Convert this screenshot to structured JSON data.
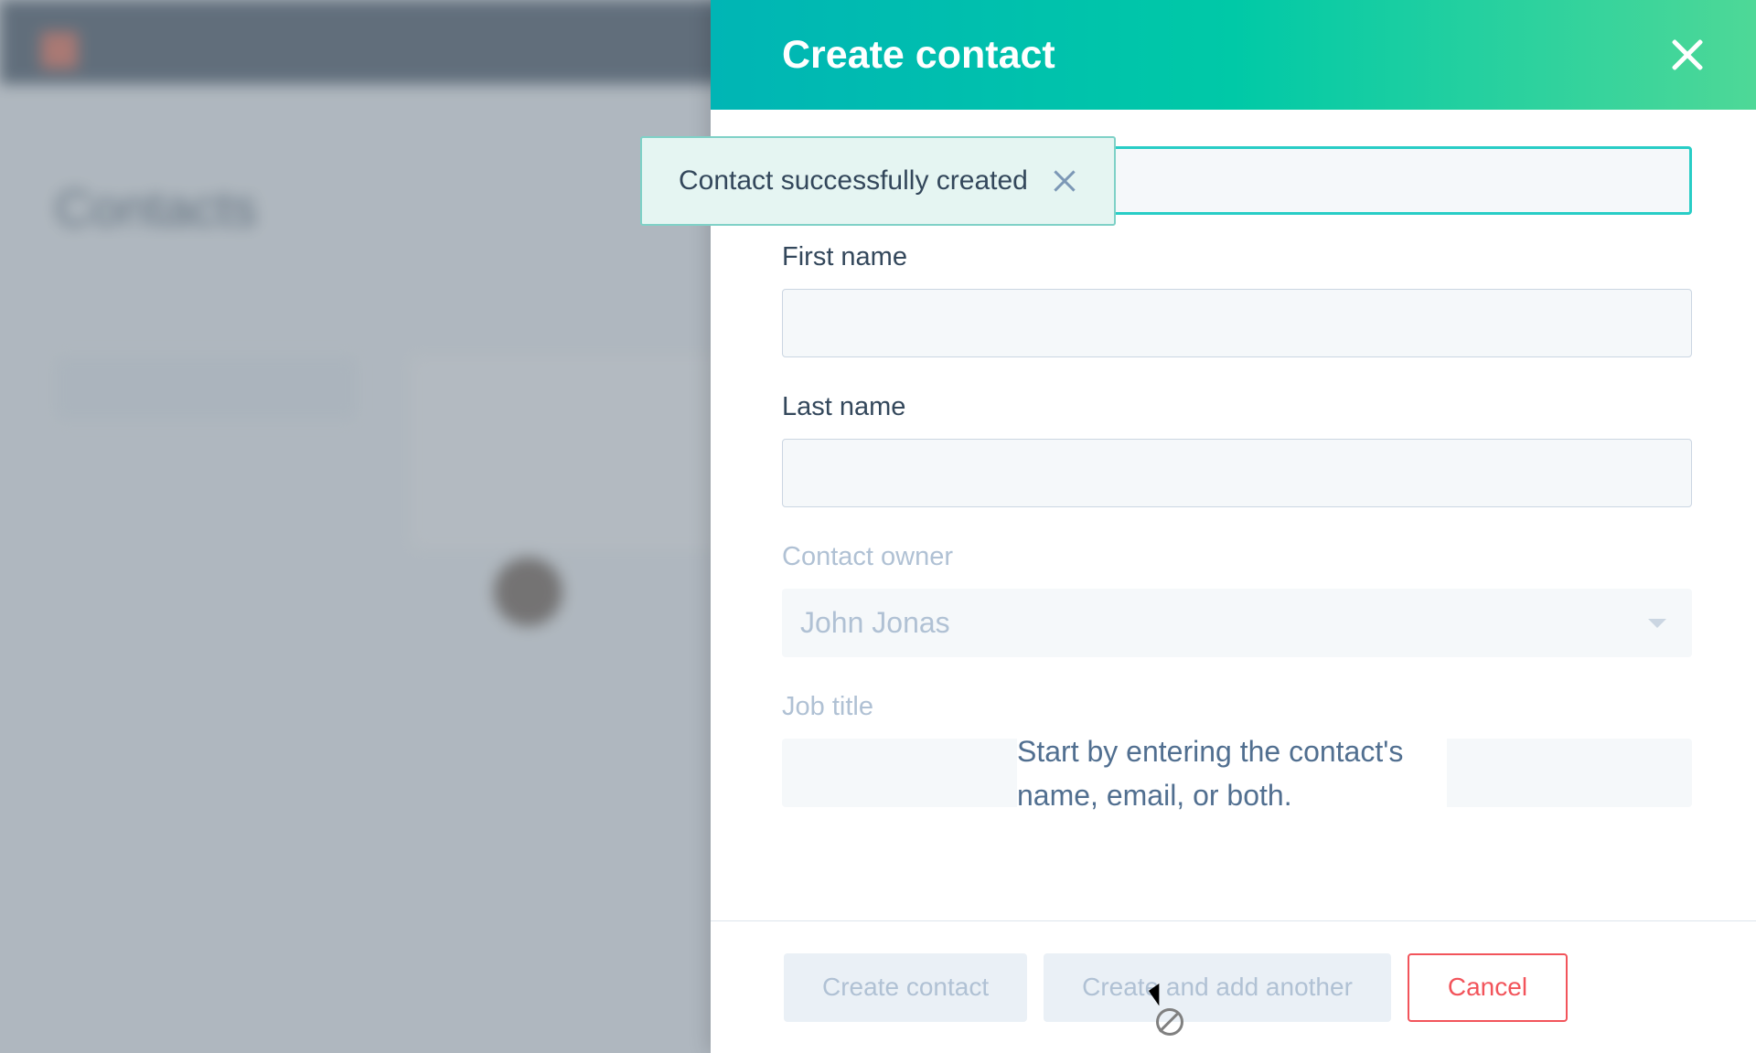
{
  "background": {
    "pageTitle": "Contacts"
  },
  "panel": {
    "title": "Create contact",
    "fields": {
      "firstNameLabel": "First name",
      "lastNameLabel": "Last name",
      "contactOwnerLabel": "Contact owner",
      "contactOwnerValue": "John Jonas",
      "jobTitleLabel": "Job title"
    },
    "footer": {
      "createLabel": "Create contact",
      "createAnotherLabel": "Create and add another",
      "cancelLabel": "Cancel"
    }
  },
  "toast": {
    "message": "Contact successfully created"
  },
  "tooltip": {
    "text": "Start by entering the contact's name, email, or both."
  }
}
